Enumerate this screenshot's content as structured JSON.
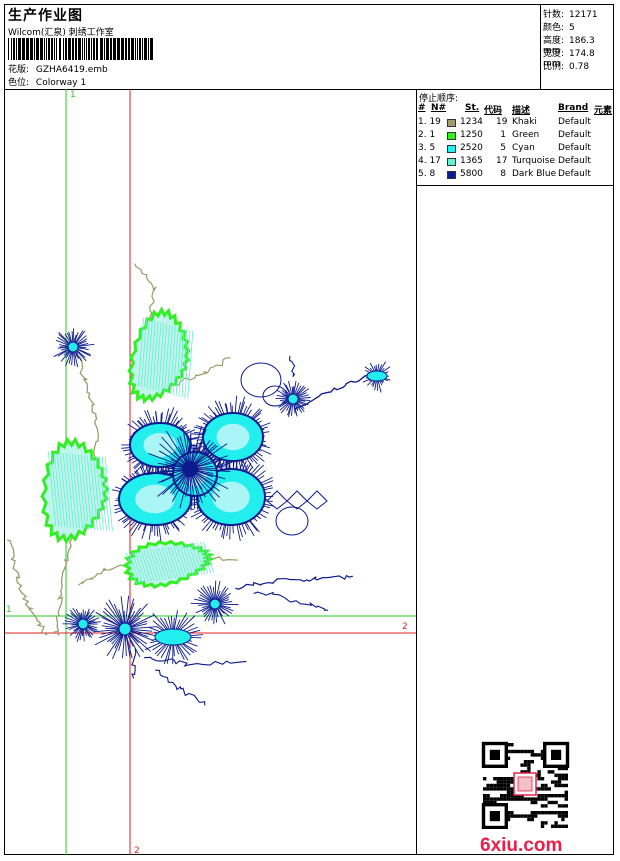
{
  "header": {
    "title": "生产作业图",
    "company": "Wilcom(汇泉) 刺绣工作室",
    "pattern_label": "花版:",
    "pattern_value": "GZHA6419.emb",
    "colorway_label": "色位:",
    "colorway_value": "Colorway 1"
  },
  "stats": [
    {
      "label": "针数:",
      "value": "12171"
    },
    {
      "label": "颜色:",
      "value": "5"
    },
    {
      "label": "高度:",
      "value": "186.3 mm"
    },
    {
      "label": "宽度:",
      "value": "174.8 mm"
    },
    {
      "label": "比例:",
      "value": "0.78"
    }
  ],
  "stop_sequence": {
    "title": "停止顺序:",
    "columns": [
      "#",
      "N#",
      "St.",
      "代码",
      "描述",
      "Brand",
      "元素"
    ],
    "rows": [
      {
        "num": "1. 19",
        "swatch": "#a09a6c",
        "st": "1234",
        "code": "19",
        "desc": "Khaki",
        "brand": "Default"
      },
      {
        "num": "2. 1",
        "swatch": "#33ee22",
        "st": "1250",
        "code": "1",
        "desc": "Green",
        "brand": "Default"
      },
      {
        "num": "3. 5",
        "swatch": "#22eeee",
        "st": "2520",
        "code": "5",
        "desc": "Cyan",
        "brand": "Default"
      },
      {
        "num": "4. 17",
        "swatch": "#66eed0",
        "st": "1365",
        "code": "17",
        "desc": "Turquoise",
        "brand": "Default"
      },
      {
        "num": "5. 8",
        "swatch": "#0b1a8c",
        "st": "5800",
        "code": "8",
        "desc": "Dark Blue",
        "brand": "Default"
      }
    ]
  },
  "guides": {
    "label_1": "1",
    "label_2": "2",
    "color_1": "#22cc22",
    "color_2": "#dd2222"
  },
  "footer": {
    "brand_text": "6xiu.com",
    "brand_color": "#e8204a",
    "qr_icon": "qr-code-icon"
  }
}
